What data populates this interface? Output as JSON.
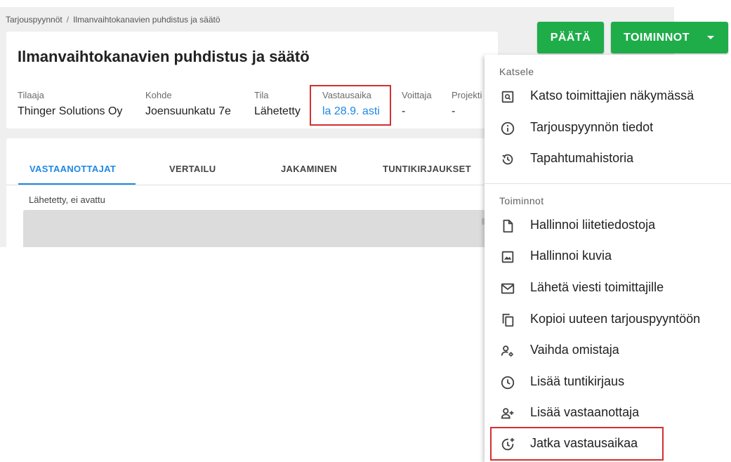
{
  "breadcrumb": {
    "root": "Tarjouspyynnöt",
    "separator": "/",
    "current": "Ilmanvaihtokanavien puhdistus ja säätö"
  },
  "page": {
    "title": "Ilmanvaihtokanavien puhdistus ja säätö"
  },
  "meta": [
    {
      "label": "Tilaaja",
      "value": "Thinger Solutions Oy"
    },
    {
      "label": "Kohde",
      "value": "Joensuunkatu 7e"
    },
    {
      "label": "Tila",
      "value": "Lähetetty"
    },
    {
      "label": "Vastausaika",
      "value": "la 28.9. asti"
    },
    {
      "label": "Voittaja",
      "value": "-"
    },
    {
      "label": "Projekti",
      "value": "-"
    }
  ],
  "tabs": [
    {
      "label": "VASTAANOTTAJAT",
      "active": true
    },
    {
      "label": "VERTAILU",
      "active": false
    },
    {
      "label": "JAKAMINEN",
      "active": false
    },
    {
      "label": "TUNTIKIRJAUKSET",
      "active": false
    }
  ],
  "status_text": "Lähetetty, ei avattu",
  "buttons": {
    "close": "PÄÄTÄ",
    "actions": "TOIMINNOT"
  },
  "menu": {
    "view_header": "Katsele",
    "view_items": [
      {
        "label": "Katso toimittajien näkymässä",
        "icon": "preview-icon"
      },
      {
        "label": "Tarjouspyynnön tiedot",
        "icon": "info-icon"
      },
      {
        "label": "Tapahtumahistoria",
        "icon": "history-icon"
      }
    ],
    "actions_header": "Toiminnot",
    "action_items": [
      {
        "label": "Hallinnoi liitetiedostoja",
        "icon": "file-icon"
      },
      {
        "label": "Hallinnoi kuvia",
        "icon": "image-icon"
      },
      {
        "label": "Lähetä viesti toimittajille",
        "icon": "mail-icon"
      },
      {
        "label": "Kopioi uuteen tarjouspyyntöön",
        "icon": "copy-icon"
      },
      {
        "label": "Vaihda omistaja",
        "icon": "user-settings-icon"
      },
      {
        "label": "Lisää tuntikirjaus",
        "icon": "clock-icon"
      },
      {
        "label": "Lisää vastaanottaja",
        "icon": "person-add-icon"
      },
      {
        "label": "Jatka vastausaikaa",
        "icon": "clock-plus-icon"
      }
    ]
  },
  "colors": {
    "primary_green": "#1fad4a",
    "link_blue": "#1e88e5",
    "highlight_red": "#d32f2f"
  }
}
